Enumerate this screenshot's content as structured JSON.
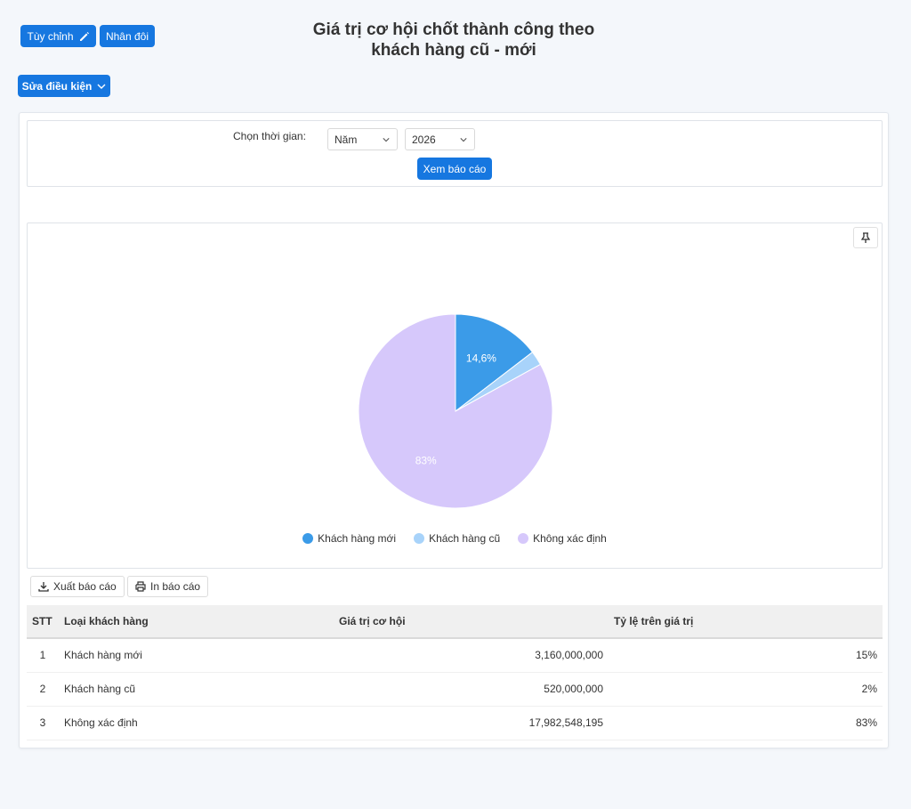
{
  "toolbar": {
    "customize_label": "Tùy chỉnh",
    "duplicate_label": "Nhân đôi",
    "edit_conditions_label": "Sửa điều kiện"
  },
  "page": {
    "title_line1": "Giá trị cơ hội chốt thành công theo",
    "title_line2": "khách hàng cũ - mới"
  },
  "filter": {
    "label": "Chọn thời gian:",
    "period_value": "Năm",
    "year_value": "2026",
    "view_button": "Xem báo cáo"
  },
  "chart_data": {
    "type": "pie",
    "labels": [
      "Khách hàng mới",
      "Khách hàng cũ",
      "Không xác định"
    ],
    "values": [
      3160000000,
      520000000,
      17982548195
    ],
    "data_labels": [
      "14,6%",
      "",
      "83%"
    ],
    "colors": [
      "#3b9be8",
      "#a8d3fa",
      "#d6c8fb"
    ],
    "legend": "bottom"
  },
  "actions": {
    "export_label": "Xuất báo cáo",
    "print_label": "In báo cáo"
  },
  "table": {
    "headers": [
      "STT",
      "Loại khách hàng",
      "Giá trị cơ hội",
      "Tỷ lệ trên giá trị"
    ],
    "rows": [
      {
        "stt": "1",
        "type": "Khách hàng mới",
        "value": "3,160,000,000",
        "ratio": "15%"
      },
      {
        "stt": "2",
        "type": "Khách hàng cũ",
        "value": "520,000,000",
        "ratio": "2%"
      },
      {
        "stt": "3",
        "type": "Không xác định",
        "value": "17,982,548,195",
        "ratio": "83%"
      }
    ]
  }
}
